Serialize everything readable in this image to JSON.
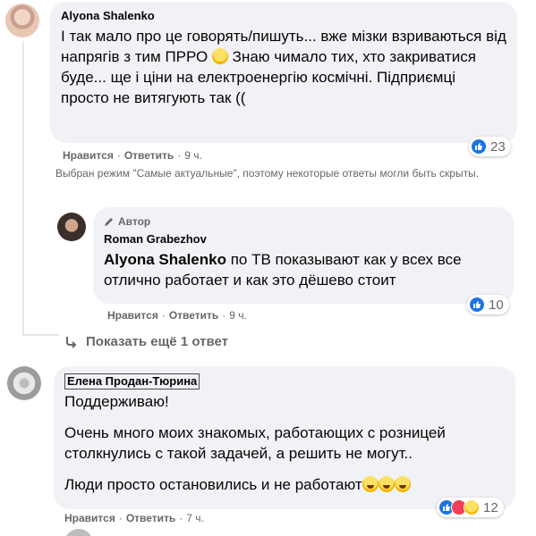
{
  "comments": [
    {
      "author": "Alyona Shalenko",
      "text": "І так мало про це говорять/пишуть... вже мізки взриваються від напрягів з тим ПРРО",
      "text_after_emoji": " Знаю чимало тих, хто закриватися буде... ще і ціни на електроенергію космічні. Підприємці просто не витягують так ((",
      "reactions_count": "23",
      "like_label": "Нравится",
      "reply_label": "Ответить",
      "time": "9 ч."
    },
    {
      "badge": "Автор",
      "author": "Roman Grabezhov",
      "mention": "Alyona Shalenko",
      "text": " по ТВ показывают как у всех все отлично работает и как это дёшево стоит",
      "reactions_count": "10",
      "like_label": "Нравится",
      "reply_label": "Ответить",
      "time": "9 ч."
    },
    {
      "author": "Елена Продан-Тюрина",
      "paragraphs": [
        "Поддерживаю!",
        "Очень много моих знакомых, работающих с розницей столкнулись с такой задачей, а решить не могут..",
        "Люди просто остановились и не работают"
      ],
      "reactions_count": "12",
      "like_label": "Нравится",
      "reply_label": "Ответить",
      "time": "7 ч."
    }
  ],
  "notice": "Выбран режим \"Самые актуальные\", поэтому некоторые ответы могли быть скрыты.",
  "show_more": "Показать ещё 1 ответ",
  "icons": {
    "like": "like-icon",
    "reply_arrow": "reply-arrow-icon",
    "pen": "pen-icon"
  },
  "colors": {
    "bubble": "#f0f2f5",
    "secondary_text": "#65676b",
    "like_blue": "#1b74e4"
  }
}
